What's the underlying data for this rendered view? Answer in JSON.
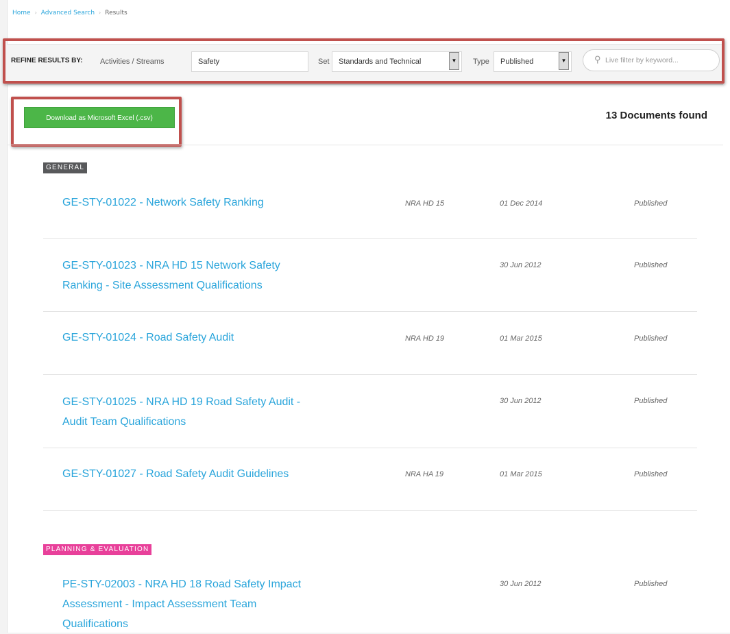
{
  "breadcrumb": {
    "home": "Home",
    "advanced_search": "Advanced Search",
    "current": "Results",
    "separator": "›"
  },
  "refine": {
    "label": "REFINE RESULTS BY:",
    "activities_label": "Activities / Streams",
    "activities_value": "Safety",
    "set_label": "Set",
    "set_value": "Standards and Technical",
    "type_label": "Type",
    "type_value": "Published",
    "search_placeholder": "Live filter by keyword..."
  },
  "actions": {
    "download_label": "Download as Microsoft Excel (.csv)",
    "results_count": "13 Documents found"
  },
  "sections": [
    {
      "badge": "GENERAL",
      "badge_color": "#58595b",
      "documents": [
        {
          "title_lines": [
            "GE-STY-01022 - Network Safety Ranking"
          ],
          "ref": "NRA HD 15",
          "date": "01 Dec 2014",
          "status": "Published"
        },
        {
          "title_lines": [
            "GE-STY-01023 - NRA HD 15 Network Safety",
            "Ranking - Site Assessment Qualifications"
          ],
          "ref": "",
          "date": "30 Jun 2012",
          "status": "Published"
        },
        {
          "title_lines": [
            "GE-STY-01024 - Road Safety Audit"
          ],
          "ref": "NRA HD 19",
          "date": "01 Mar 2015",
          "status": "Published"
        },
        {
          "title_lines": [
            "GE-STY-01025 - NRA HD 19 Road Safety Audit -",
            "Audit Team Qualifications"
          ],
          "ref": "",
          "date": "30 Jun 2012",
          "status": "Published"
        },
        {
          "title_lines": [
            "GE-STY-01027 - Road Safety Audit Guidelines"
          ],
          "ref": "NRA HA 19",
          "date": "01 Mar 2015",
          "status": "Published"
        }
      ]
    },
    {
      "badge": "PLANNING & EVALUATION",
      "badge_color": "#e8409a",
      "documents": [
        {
          "title_lines": [
            "PE-STY-02003 - NRA HD 18 Road Safety Impact",
            "Assessment - Impact Assessment Team",
            "Qualifications"
          ],
          "ref": "",
          "date": "30 Jun 2012",
          "status": "Published"
        }
      ]
    }
  ],
  "colors": {
    "link": "#2aa5db",
    "download_button": "#4cb648",
    "highlight_border": "#c0504d"
  },
  "icons": {
    "search": "search-icon",
    "dropdown": "chevron-down-icon"
  }
}
